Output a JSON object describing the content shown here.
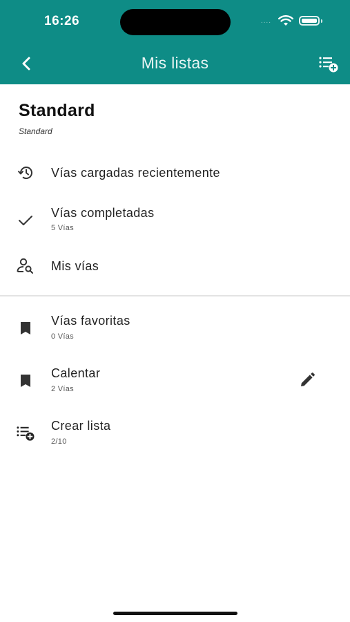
{
  "status_bar": {
    "time": "16:26",
    "signal_dots": "....",
    "wifi_icon": "wifi-icon",
    "battery_icon": "battery-icon"
  },
  "colors": {
    "header_bg": "#0e8c86",
    "header_text": "#ffffff",
    "body_bg": "#ffffff",
    "text_primary": "#222222"
  },
  "nav": {
    "back_icon": "chevron-left-icon",
    "title": "Mis listas",
    "action_icon": "playlist-add-icon"
  },
  "profile": {
    "title": "Standard",
    "subtitle": "Standard"
  },
  "lists_system": [
    {
      "label": "Vías cargadas recientemente",
      "sub": "",
      "icon": "history-icon"
    },
    {
      "label": "Vías completadas",
      "sub": "5 Vías",
      "icon": "check-icon"
    },
    {
      "label": "Mis vías",
      "sub": "",
      "icon": "person-search-icon"
    }
  ],
  "lists_user": [
    {
      "label": "Vías favoritas",
      "sub": "0 Vías",
      "icon": "bookmark-icon"
    },
    {
      "label": "Calentar",
      "sub": "2 Vías",
      "icon": "bookmark-icon",
      "action_icon": "pencil-icon"
    },
    {
      "label": "Crear lista",
      "sub": "2/10",
      "icon": "playlist-add-icon"
    }
  ]
}
